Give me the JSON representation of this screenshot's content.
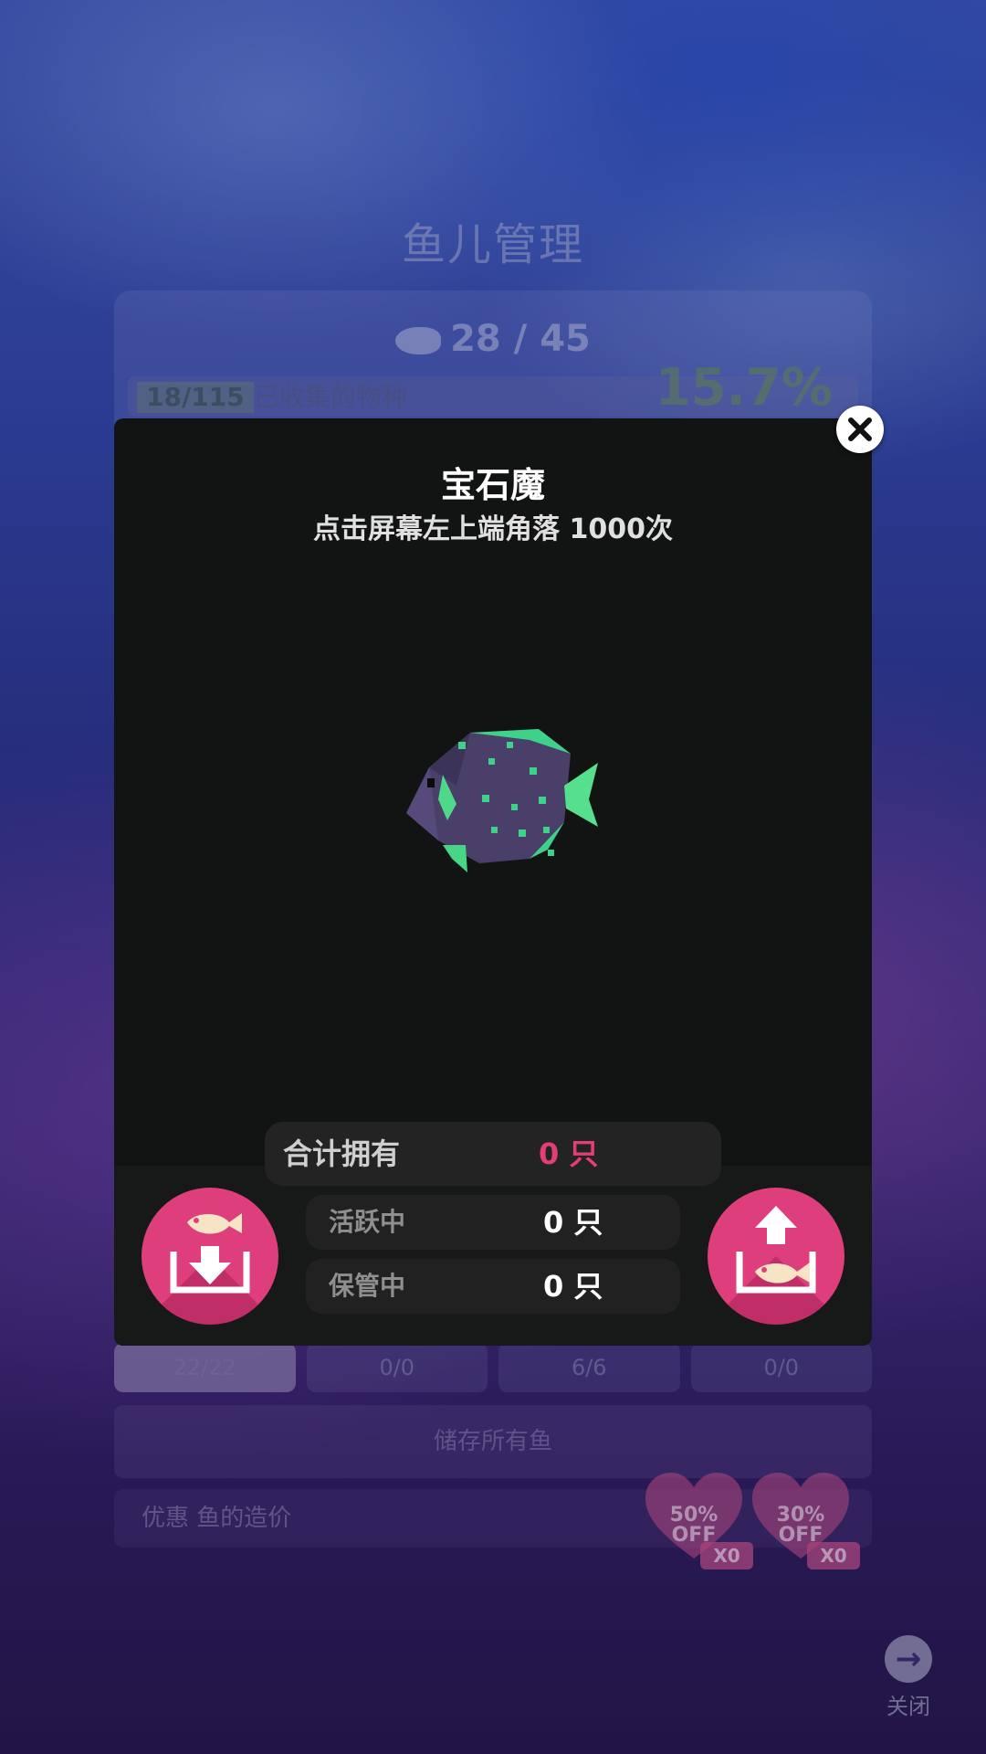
{
  "background": {
    "title": "鱼儿管理",
    "fish_count": "28 / 45",
    "species_progress": "18/115",
    "species_label": "已收集的物种",
    "percent": "15.7%",
    "tabs": [
      {
        "value": "22/22",
        "active": true
      },
      {
        "value": "0/0",
        "active": false
      },
      {
        "value": "6/6",
        "active": false
      },
      {
        "value": "0/0",
        "active": false
      }
    ],
    "store_all_label": "储存所有鱼",
    "discount_label": "优惠 鱼的造价",
    "discounts": [
      {
        "text": "50%\nOFF",
        "line1": "50%",
        "line2": "OFF",
        "count": "X0"
      },
      {
        "text": "30%\nOFF",
        "line1": "30%",
        "line2": "OFF",
        "count": "X0"
      }
    ],
    "close_label": "关闭"
  },
  "modal": {
    "title": "宝石魔",
    "description": "点击屏幕左上端角落 1000次",
    "total_label": "合计拥有",
    "total_value": "0 只",
    "active_label": "活跃中",
    "active_value": "0 只",
    "stored_label": "保管中",
    "stored_value": "0 只"
  },
  "icons": {
    "close": "close-icon",
    "store": "store-fish-icon",
    "release": "release-fish-icon"
  },
  "colors": {
    "accent": "#de3f7c",
    "total_value": "#e33f75",
    "modal_bg": "#121414",
    "fish_body": "#4a3f68",
    "fish_fin": "#3fd08a"
  }
}
